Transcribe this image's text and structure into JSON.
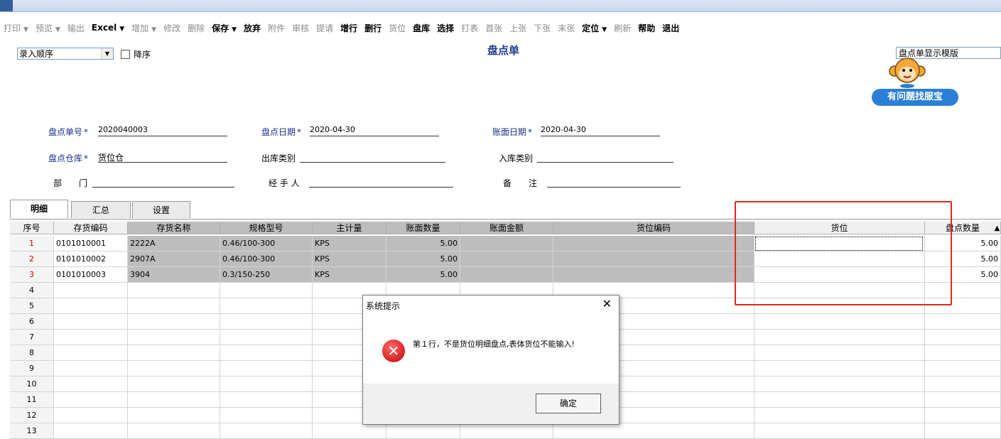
{
  "toolbar": [
    {
      "label": "打印",
      "dropdown": true,
      "enabled": false
    },
    {
      "label": "预览",
      "dropdown": true,
      "enabled": false
    },
    {
      "label": "输出",
      "dropdown": false,
      "enabled": false
    },
    {
      "label": "Excel",
      "dropdown": true,
      "enabled": true
    },
    {
      "label": "增加",
      "dropdown": true,
      "enabled": false
    },
    {
      "label": "修改",
      "dropdown": false,
      "enabled": false
    },
    {
      "label": "删除",
      "dropdown": false,
      "enabled": false
    },
    {
      "label": "保存",
      "dropdown": true,
      "enabled": true
    },
    {
      "label": "放弃",
      "dropdown": false,
      "enabled": true
    },
    {
      "label": "附件",
      "dropdown": false,
      "enabled": false
    },
    {
      "label": "审核",
      "dropdown": false,
      "enabled": false
    },
    {
      "label": "提请",
      "dropdown": false,
      "enabled": false
    },
    {
      "label": "增行",
      "dropdown": false,
      "enabled": true
    },
    {
      "label": "删行",
      "dropdown": false,
      "enabled": true
    },
    {
      "label": "货位",
      "dropdown": false,
      "enabled": false
    },
    {
      "label": "盘库",
      "dropdown": false,
      "enabled": true
    },
    {
      "label": "选择",
      "dropdown": false,
      "enabled": true
    },
    {
      "label": "打表",
      "dropdown": false,
      "enabled": false
    },
    {
      "label": "首张",
      "dropdown": false,
      "enabled": false
    },
    {
      "label": "上张",
      "dropdown": false,
      "enabled": false
    },
    {
      "label": "下张",
      "dropdown": false,
      "enabled": false
    },
    {
      "label": "末张",
      "dropdown": false,
      "enabled": false
    },
    {
      "label": "定位",
      "dropdown": true,
      "enabled": true
    },
    {
      "label": "刷新",
      "dropdown": false,
      "enabled": false
    },
    {
      "label": "帮助",
      "dropdown": false,
      "enabled": true
    },
    {
      "label": "退出",
      "dropdown": false,
      "enabled": true
    }
  ],
  "sort": {
    "value": "录入顺序",
    "descending_label": "降序"
  },
  "doc_title": "盘点单",
  "template_select": "盘点单显示模版",
  "help_button": "有问题找服宝",
  "header_fields": {
    "doc_no_label": "盘点单号",
    "doc_no_value": "2020040003",
    "check_date_label": "盘点日期",
    "check_date_value": "2020-04-30",
    "book_date_label": "账面日期",
    "book_date_value": "2020-04-30",
    "warehouse_label": "盘点仓库",
    "warehouse_value": "货位仓",
    "out_type_label": "出库类别",
    "in_type_label": "入库类别",
    "dept_label": "部　　门",
    "handler_label": "经 手 人",
    "remark_label": "备　　注",
    "required_mark": "*"
  },
  "tabs": [
    "明细",
    "汇总",
    "设置"
  ],
  "grid": {
    "columns": [
      "序号",
      "存货编码",
      "存货名称",
      "规格型号",
      "主计量",
      "账面数量",
      "账面金额",
      "货位编码",
      "货位",
      "盘点数量"
    ],
    "rows": [
      {
        "no": "1",
        "code": "0101010001",
        "name": "2222A",
        "spec": "0.46/100-300",
        "unit": "KPS",
        "qty": "5.00",
        "count": "5.00"
      },
      {
        "no": "2",
        "code": "0101010002",
        "name": "2907A",
        "spec": "0.46/100-300",
        "unit": "KPS",
        "qty": "5.00",
        "count": "5.00"
      },
      {
        "no": "3",
        "code": "0101010003",
        "name": "3904",
        "spec": "0.3/150-250",
        "unit": "KPS",
        "qty": "5.00",
        "count": "5.00"
      },
      {
        "no": "4"
      },
      {
        "no": "5"
      },
      {
        "no": "6"
      },
      {
        "no": "7"
      },
      {
        "no": "8"
      },
      {
        "no": "9"
      },
      {
        "no": "10"
      },
      {
        "no": "11"
      },
      {
        "no": "12"
      },
      {
        "no": "13"
      }
    ]
  },
  "dialog": {
    "title": "系统提示",
    "message": "第１行，不是货位明细盘点,表体货位不能输入!",
    "ok": "确定"
  }
}
